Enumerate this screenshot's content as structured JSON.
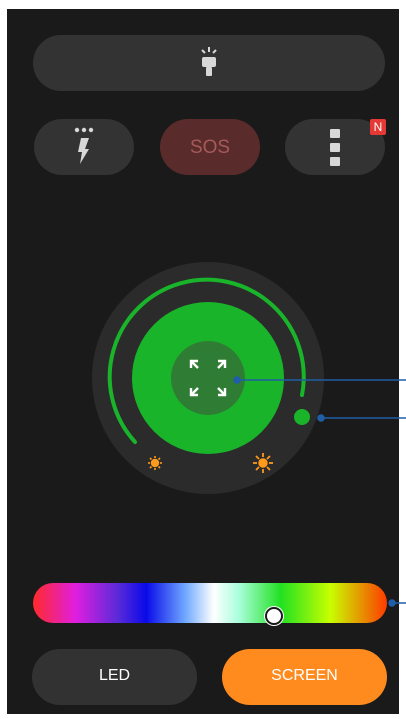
{
  "app": {
    "torch_button": {
      "icon": "flashlight-icon"
    },
    "strobe_button": {
      "icon": "lightning-dots-icon"
    },
    "sos_button": {
      "label": "SOS"
    },
    "menu_button": {
      "icon": "vertical-dots-icon",
      "badge": "N"
    },
    "brightness_dial": {
      "center_icon": "expand-arrows-icon",
      "min_icon": "dim-sun-icon",
      "max_icon": "bright-sun-icon"
    },
    "color_slider": {
      "position": 0.68
    },
    "modes": [
      {
        "label": "LED",
        "active": false
      },
      {
        "label": "SCREEN",
        "active": true
      }
    ]
  },
  "colors": {
    "background": "#1a1a1a",
    "button": "#333333",
    "sos": "#5a2b2b",
    "accent_green": "#19b42a",
    "inner_green": "#2f7d34",
    "active_mode": "#ff8a1e",
    "sun_icon": "#ff9a1a",
    "annotation": "#1f5ea8"
  }
}
